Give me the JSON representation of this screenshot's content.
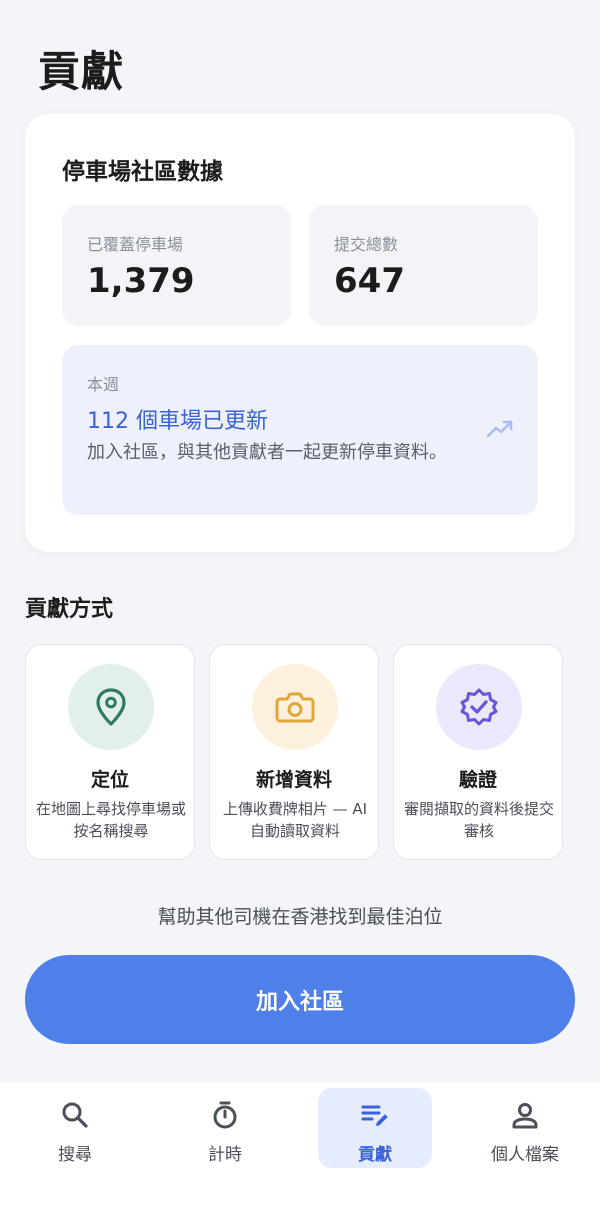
{
  "page": {
    "title": "貢獻"
  },
  "stats": {
    "title": "停車場社區數據",
    "covered_label": "已覆蓋停車場",
    "covered_value": "1,379",
    "submissions_label": "提交總數",
    "submissions_value": "647",
    "weekly": {
      "label": "本週",
      "headline": "112 個車場已更新",
      "description": "加入社區，與其他貢獻者一起更新停車資料。",
      "icon": "trending-up-icon"
    }
  },
  "methods": {
    "title": "貢獻方式",
    "items": [
      {
        "name": "定位",
        "description": "在地圖上尋找停車場或按名稱搜尋",
        "icon": "location-pin-icon",
        "color": "#2f7a63",
        "bg": "#e3f0ea"
      },
      {
        "name": "新增資料",
        "description": "上傳收費牌相片 — AI 自動讀取資料",
        "icon": "camera-icon",
        "color": "#e2a53a",
        "bg": "#fdf0dc"
      },
      {
        "name": "驗證",
        "description": "審閱擷取的資料後提交審核",
        "icon": "verified-badge-icon",
        "color": "#6a55d9",
        "bg": "#ece8fb"
      }
    ]
  },
  "help_text": "幫助其他司機在香港找到最佳泊位",
  "join_button": "加入社區",
  "nav": {
    "active_color": "#3b63d8",
    "items": [
      {
        "label": "搜尋",
        "icon": "search-icon"
      },
      {
        "label": "計時",
        "icon": "stopwatch-icon"
      },
      {
        "label": "貢獻",
        "icon": "edit-list-icon",
        "active": true
      },
      {
        "label": "個人檔案",
        "icon": "person-icon"
      }
    ]
  }
}
